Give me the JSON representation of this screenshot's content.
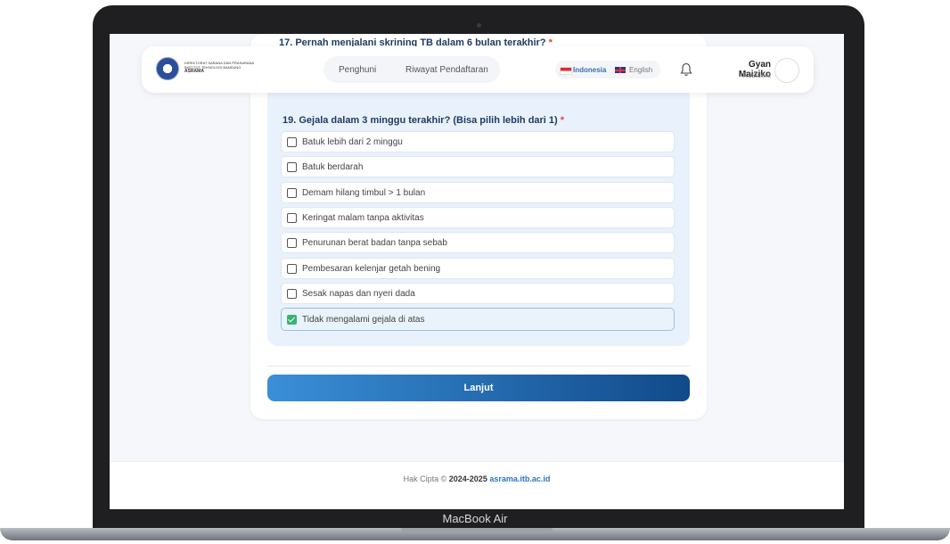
{
  "device": {
    "brand": "MacBook Air"
  },
  "header": {
    "org_line1": "DIREKTORAT SARANA DAN PRASARANA",
    "org_line2": "INSTITUT TEKNOLOGI BANDUNG",
    "org_line3": "ASRAMA",
    "nav": [
      "Penghuni",
      "Riwayat Pendaftaran"
    ],
    "lang_id": "Indonesia",
    "lang_en": "English",
    "user_name": "Gyan Maiziko",
    "user_role": "Resident"
  },
  "form": {
    "q17": "17. Pernah menjalani skrining TB dalam 6 bulan terakhir?",
    "q19": "19. Gejala dalam 3 minggu terakhir? (Bisa pilih lebih dari 1)",
    "required_mark": "*",
    "options": [
      {
        "label": "Batuk lebih dari 2 minggu",
        "checked": false
      },
      {
        "label": "Batuk berdarah",
        "checked": false
      },
      {
        "label": "Demam hilang timbul > 1 bulan",
        "checked": false
      },
      {
        "label": "Keringat malam tanpa aktivitas",
        "checked": false
      },
      {
        "label": "Penurunan berat badan tanpa sebab",
        "checked": false
      },
      {
        "label": "Pembesaran kelenjar getah bening",
        "checked": false
      },
      {
        "label": "Sesak napas dan nyeri dada",
        "checked": false
      },
      {
        "label": "Tidak mengalami gejala di atas",
        "checked": true
      }
    ],
    "submit": "Lanjut"
  },
  "footer": {
    "copyright": "Hak Cipta ©",
    "years": "2024-2025",
    "site": "asrama.itb.ac.id"
  },
  "colors": {
    "accent": "#2d73c4",
    "check": "#3bb273",
    "button_start": "#3a8fd8",
    "button_end": "#114a8a"
  }
}
